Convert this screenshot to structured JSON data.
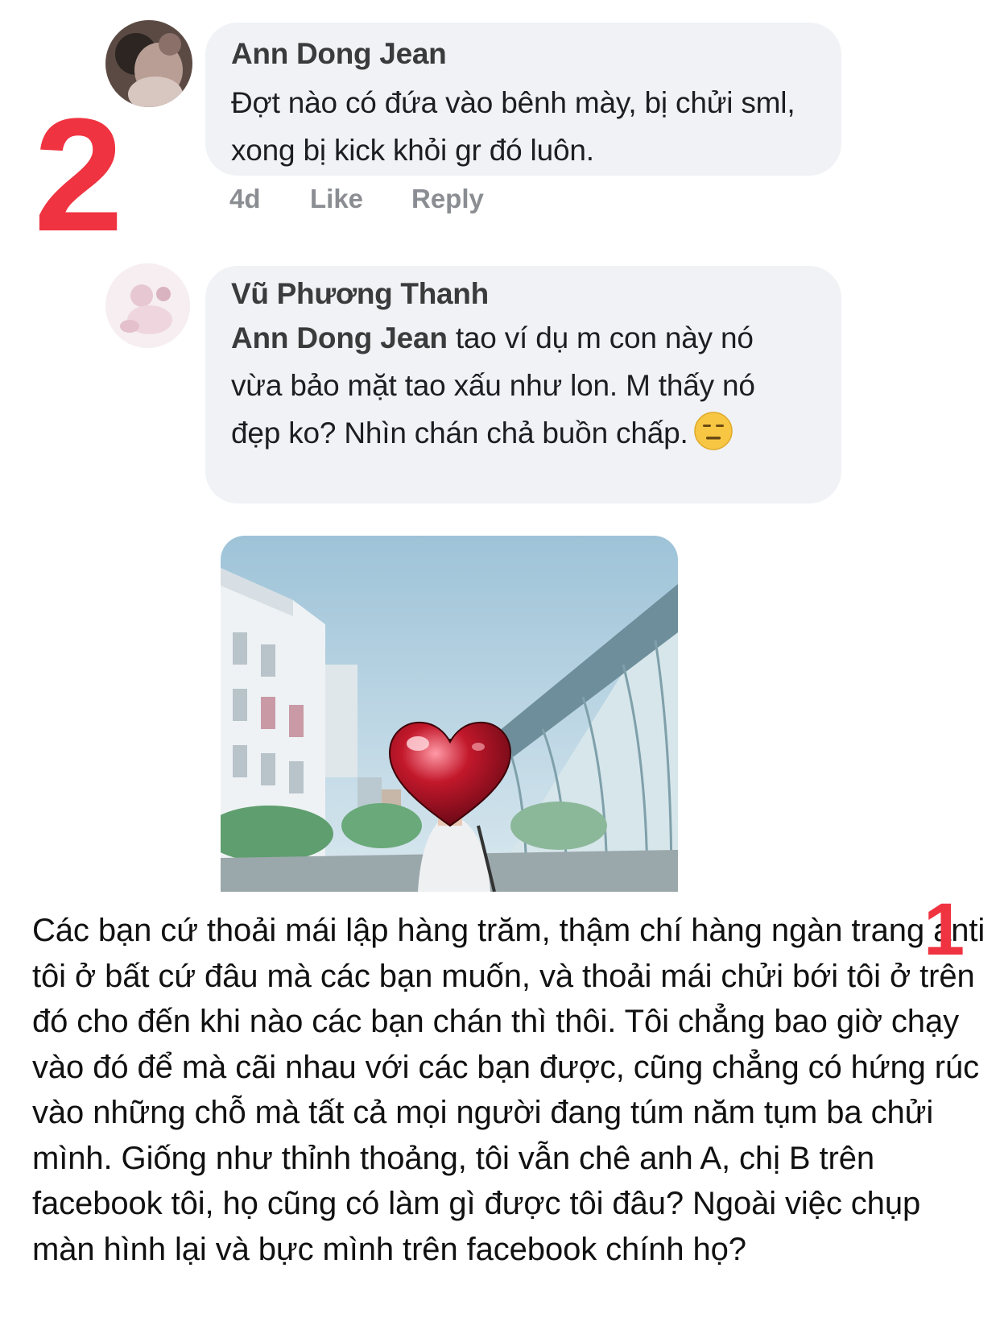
{
  "comment1": {
    "author": "Ann Dong Jean",
    "text": "Đợt nào có đứa vào bênh mày, bị chửi sml, xong bị kick khỏi gr đó luôn.",
    "time": "4d",
    "like_label": "Like",
    "reply_label": "Reply"
  },
  "comment2": {
    "author": "Vũ Phương Thanh",
    "mention": "Ann Dong Jean",
    "text": " tao ví dụ m con này nó vừa bảo mặt tao xấu như lon. M thấy nó đẹp ko? Nhìn chán chả buồn chấp.",
    "emoji": "neutral-face-emoji"
  },
  "annotations": {
    "marker_top": "2",
    "marker_bottom": "1"
  },
  "post": {
    "text": "Các bạn cứ thoải mái lập hàng trăm, thậm chí hàng ngàn trang anti tôi ở bất cứ đâu mà các bạn muốn, và thoải mái chửi bới tôi ở trên đó cho đến khi nào các bạn chán thì thôi. Tôi chẳng bao giờ chạy vào đó để mà cãi nhau với các bạn được, cũng chẳng có hứng rúc vào những chỗ mà tất cả mọi người đang túm năm tụm ba chửi mình. Giống như thỉnh thoảng, tôi vẫn chê anh A, chị B trên facebook tôi, họ cũng có làm gì được tôi đâu? Ngoài việc chụp màn hình lại và bực mình trên facebook chính họ?"
  },
  "colors": {
    "bubble": "#f0f2f5",
    "marker": "#ef3340",
    "meta": "#8a8d91"
  }
}
